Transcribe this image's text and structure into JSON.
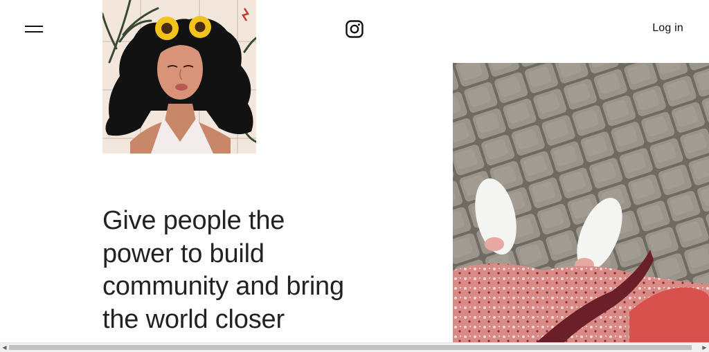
{
  "header": {
    "menu_icon": "hamburger-menu-icon",
    "logo_icon": "instagram-logo-icon",
    "login_label": "Log in"
  },
  "hero": {
    "headline_lines": [
      "Give people the",
      "power to build",
      "community and bring",
      "the world closer"
    ]
  },
  "images": {
    "illustration_icon": "illustrated-woman-sunflowers-image",
    "photo_icon": "feet-on-cobblestone-photo"
  },
  "scrollbar": {
    "left_arrow": "◀",
    "right_arrow": "▶",
    "position": 0
  },
  "colors": {
    "text": "#222222",
    "background": "#ffffff",
    "scrollbar_thumb": "#c1c1c1"
  }
}
